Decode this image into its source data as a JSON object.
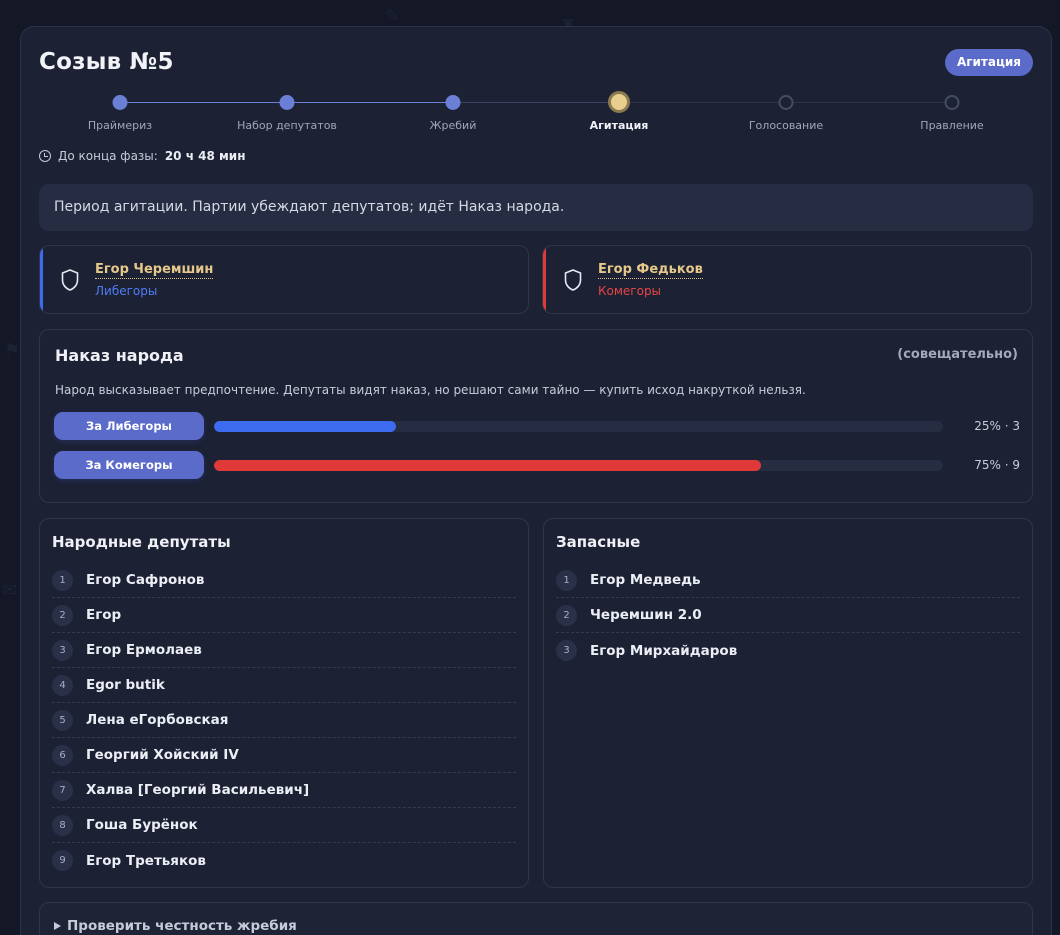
{
  "header": {
    "title": "Созыв №5",
    "phase_badge": "Агитация"
  },
  "stepper": {
    "steps": [
      {
        "label": "Праймериз",
        "state": "done"
      },
      {
        "label": "Набор депутатов",
        "state": "done"
      },
      {
        "label": "Жребий",
        "state": "done"
      },
      {
        "label": "Агитация",
        "state": "current"
      },
      {
        "label": "Голосование",
        "state": "future"
      },
      {
        "label": "Правление",
        "state": "future"
      }
    ]
  },
  "timer": {
    "label": "До конца фазы:",
    "value": "20 ч 48 мин"
  },
  "info": {
    "text": "Период агитации. Партии убеждают депутатов; идёт Наказ народа."
  },
  "parties": [
    {
      "leader": "Егор Черемшин",
      "name": "Либегоры",
      "color": "#3d6cf0",
      "icon": "shield-icon"
    },
    {
      "leader": "Егор Федьков",
      "name": "Комегоры",
      "color": "#e0393a",
      "icon": "shield-icon"
    }
  ],
  "mandate": {
    "title": "Наказ народа",
    "advisory": "(совещательно)",
    "description": "Народ высказывает предпочтение. Депутаты видят наказ, но решают сами тайно — купить исход накруткой нельзя.",
    "votes": [
      {
        "button": "За Либегоры",
        "percent": 25,
        "label": "25% · 3",
        "color": "#3d6cf0"
      },
      {
        "button": "За Комегоры",
        "percent": 75,
        "label": "75% · 9",
        "color": "#e0393a"
      }
    ]
  },
  "deputies": {
    "title": "Народные депутаты",
    "items": [
      {
        "num": "1",
        "name": "Егор Сафронов"
      },
      {
        "num": "2",
        "name": "Егор"
      },
      {
        "num": "3",
        "name": "Егор Ермолаев"
      },
      {
        "num": "4",
        "name": "Egor butik"
      },
      {
        "num": "5",
        "name": "Лена еГорбовская"
      },
      {
        "num": "6",
        "name": "Георгий Хойский IV"
      },
      {
        "num": "7",
        "name": "Халва [Георгий Васильевич]"
      },
      {
        "num": "8",
        "name": "Гоша Бурёнок"
      },
      {
        "num": "9",
        "name": "Егор Третьяков"
      }
    ]
  },
  "reserves": {
    "title": "Запасные",
    "items": [
      {
        "num": "1",
        "name": "Егор Медведь"
      },
      {
        "num": "2",
        "name": "Черемшин 2.0"
      },
      {
        "num": "3",
        "name": "Егор Мирхайдаров"
      }
    ]
  },
  "details": {
    "summary": "Проверить честность жребия"
  }
}
